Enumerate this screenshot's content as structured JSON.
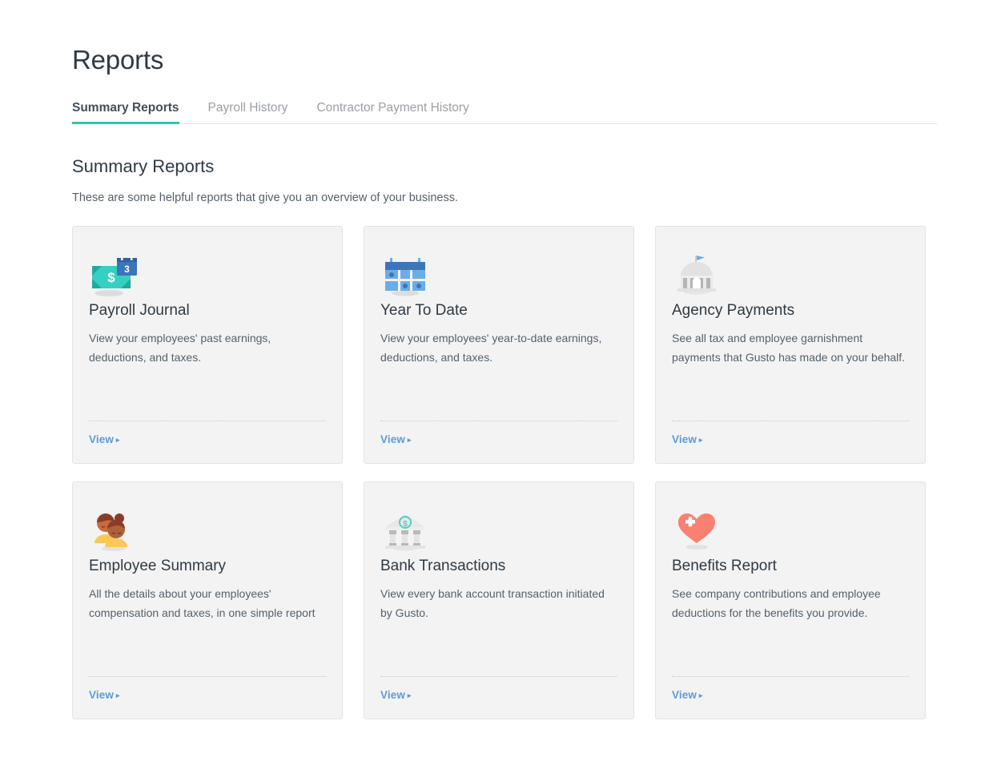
{
  "page": {
    "title": "Reports"
  },
  "tabs": [
    {
      "label": "Summary Reports",
      "active": true
    },
    {
      "label": "Payroll History",
      "active": false
    },
    {
      "label": "Contractor Payment History",
      "active": false
    }
  ],
  "section": {
    "title": "Summary Reports",
    "subtitle": "These are some helpful reports that give you an overview of your business."
  },
  "cards": [
    {
      "icon": "money-calendar-icon",
      "badge_number": "3",
      "title": "Payroll Journal",
      "description": "View your employees' past earnings, deductions, and taxes.",
      "view_label": "View",
      "caret": "▸"
    },
    {
      "icon": "calendar-icon",
      "title": "Year To Date",
      "description": "View your employees' year-to-date earnings, deductions, and taxes.",
      "view_label": "View",
      "caret": "▸"
    },
    {
      "icon": "government-building-icon",
      "title": "Agency Payments",
      "description": "See all tax and employee garnishment payments that Gusto has made on your behalf.",
      "view_label": "View",
      "caret": "▸"
    },
    {
      "icon": "two-people-icon",
      "title": "Employee Summary",
      "description": "All the details about your employees' compensation and taxes, in one simple report",
      "view_label": "View",
      "caret": "▸"
    },
    {
      "icon": "bank-icon",
      "title": "Bank Transactions",
      "description": "View every bank account transaction initiated by Gusto.",
      "view_label": "View",
      "caret": "▸"
    },
    {
      "icon": "heart-plus-icon",
      "title": "Benefits Report",
      "description": "See company contributions and employee deductions for the benefits you provide.",
      "view_label": "View",
      "caret": "▸"
    }
  ],
  "colors": {
    "accent_teal": "#2ec4b0",
    "link_blue": "#5b9bd8",
    "card_bg": "#f3f3f3",
    "card_border": "#e4e4e4",
    "heading": "#2f3a44",
    "body_text": "#55616d",
    "muted_tab": "#9b9fa5",
    "money_teal": "#35d0bf",
    "calendar_blue": "#6aade8",
    "calendar_header_blue": "#3c75b8",
    "building_gray": "#e0e0e0",
    "flag_blue": "#6aade8",
    "skin_tone": "#c96a3d",
    "hair_brown": "#8c3b28",
    "shirt_yellow": "#fbc758",
    "heart_salmon": "#fa8072"
  }
}
